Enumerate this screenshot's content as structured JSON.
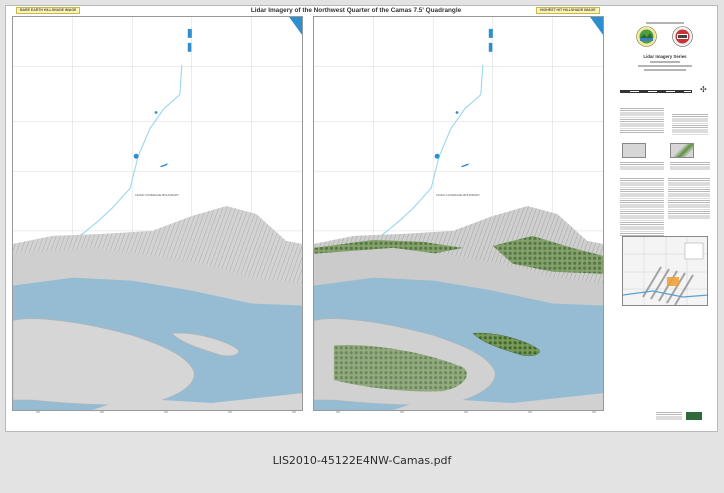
{
  "map": {
    "title": "Lidar Imagery of the Northwest Quarter of the Camas 7.5' Quadrangle",
    "left_tag": "BARE EARTH HILLSHADE IMAGE",
    "right_tag": "HIGHEST HIT HILLSHADE IMAGE",
    "left_ticks": [
      "000",
      "000",
      "000",
      "000",
      "000"
    ],
    "right_ticks": [
      "000",
      "000",
      "000",
      "000",
      "000"
    ]
  },
  "side": {
    "series_title": "Lidar Imagery Series",
    "colors": {
      "water": "#9cc3d6",
      "bare_earth": "#d7d7d7",
      "vegetation": "#4d7a36",
      "river_light": "#9ad6ee",
      "sheet_bg": "#e3e3e3"
    }
  },
  "footer": {
    "filename": "LIS2010-45122E4NW-Camas.pdf"
  }
}
